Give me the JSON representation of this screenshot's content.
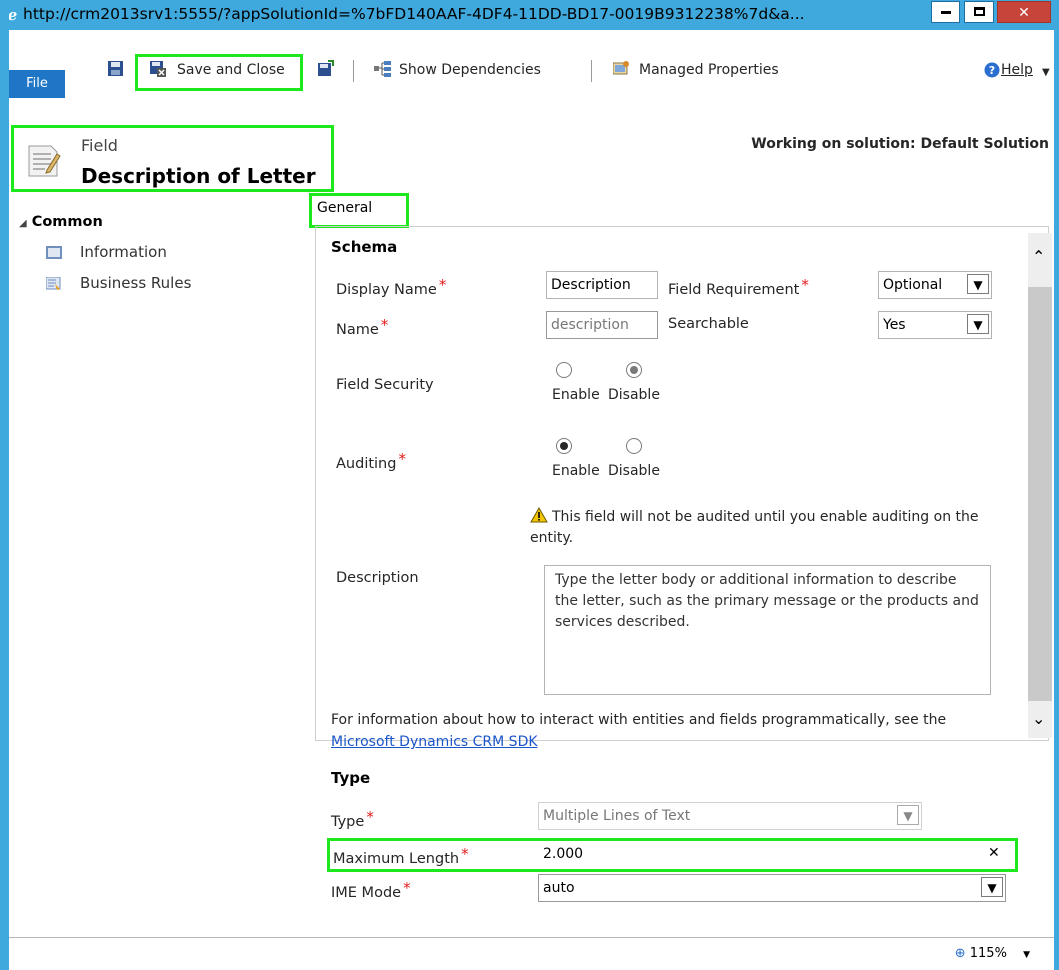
{
  "window": {
    "title": "http://crm2013srv1:5555/?appSolutionId=%7bFD140AAF-4DF4-11DD-BD17-0019B9312238%7d&a..."
  },
  "toolbar": {
    "file": "File",
    "save_close": "Save and Close",
    "show_dependencies": "Show Dependencies",
    "managed_properties": "Managed Properties",
    "help": "Help"
  },
  "header": {
    "entity_type": "Field",
    "title": "Description of Letter",
    "working_on": "Working on solution: Default Solution"
  },
  "nav": {
    "section": "Common",
    "items": [
      {
        "label": "Information"
      },
      {
        "label": "Business Rules"
      }
    ]
  },
  "tab": "General",
  "schema": {
    "heading": "Schema",
    "display_name_label": "Display Name",
    "display_name_value": "Description",
    "field_requirement_label": "Field Requirement",
    "field_requirement_value": "Optional",
    "name_label": "Name",
    "name_value": "description",
    "searchable_label": "Searchable",
    "searchable_value": "Yes",
    "field_security_label": "Field Security",
    "enable": "Enable",
    "disable": "Disable",
    "field_security_selected": "Disable",
    "auditing_label": "Auditing",
    "auditing_selected": "Enable",
    "audit_warning": "This field will not be audited until you enable auditing on the entity.",
    "description_label": "Description",
    "description_value": "Type the letter body or additional information to describe the letter, such as the primary message or the products and services described.",
    "sdk_info": "For information about how to interact with entities and fields programmatically, see the",
    "sdk_link": "Microsoft Dynamics CRM SDK"
  },
  "type_section": {
    "heading": "Type",
    "type_label": "Type",
    "type_value": "Multiple Lines of Text",
    "max_length_label": "Maximum Length",
    "max_length_value": "2.000",
    "ime_mode_label": "IME Mode",
    "ime_mode_value": "auto"
  },
  "status": {
    "zoom": "115%"
  },
  "colors": {
    "highlight": "#1ce81c",
    "titlebar": "#3fa9dd",
    "file_button": "#1f76c6",
    "required": "#e31b1b",
    "link": "#1a55c9"
  }
}
